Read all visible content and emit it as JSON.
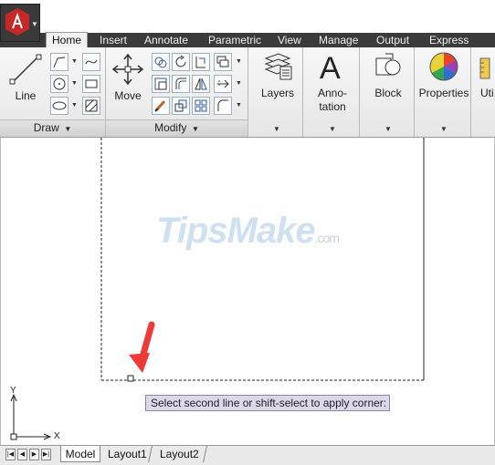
{
  "tabs": [
    "Home",
    "Insert",
    "Annotate",
    "Parametric",
    "View",
    "Manage",
    "Output",
    "Express Tools"
  ],
  "ribbon": {
    "draw": {
      "line_label": "Line",
      "panel_label": "Draw"
    },
    "modify": {
      "move_label": "Move",
      "panel_label": "Modify"
    },
    "layers_label": "Layers",
    "annotation_label_1": "Anno-",
    "annotation_label_2": "tation",
    "block_label": "Block",
    "properties_label": "Properties",
    "utilities_label": "Uti"
  },
  "canvas": {
    "watermark_main": "TipsMake",
    "watermark_suffix": ".com",
    "ucs_y": "Y",
    "ucs_x": "X",
    "prompt": "Select second line or shift-select to apply corner:"
  },
  "layout_tabs": [
    "Model",
    "Layout1",
    "Layout2"
  ],
  "colors": {
    "accent_arrow": "#f03a3a",
    "tab_bar": "#3b3b3b",
    "prompt_bg": "#dcd8ea"
  }
}
